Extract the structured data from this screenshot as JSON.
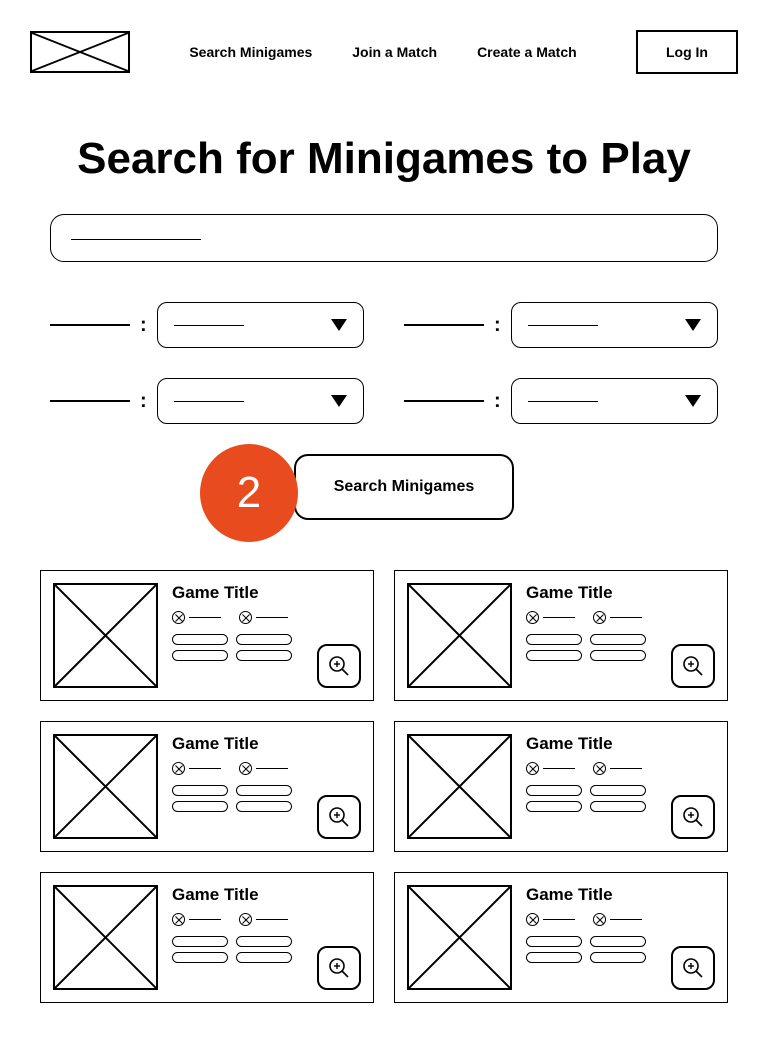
{
  "header": {
    "nav": {
      "search": "Search Minigames",
      "join": "Join a Match",
      "create": "Create a Match"
    },
    "login_label": "Log In"
  },
  "page_title": "Search for Minigames to Play",
  "badge_number": "2",
  "search_button_label": "Search Minigames",
  "card_title": "Game Title",
  "results_count": 6
}
